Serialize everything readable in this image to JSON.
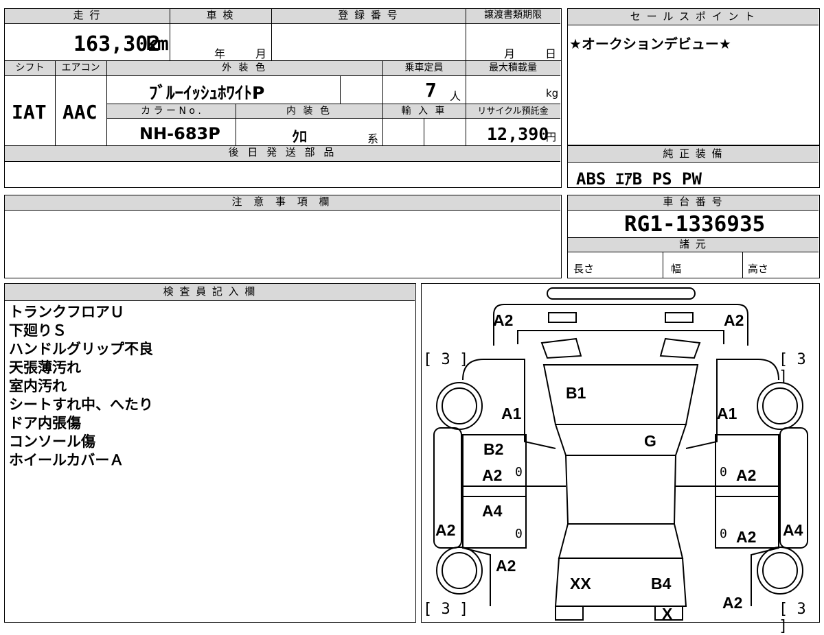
{
  "top_row": {
    "mileage_label": "走 行",
    "mileage_value": "163,302",
    "mileage_unit": "km",
    "inspection_label": "車 検",
    "inspection_year": "年",
    "inspection_month": "月",
    "registration_label": "登 録 番 号",
    "transfer_label": "譲渡書類期限",
    "transfer_month": "月",
    "transfer_day": "日"
  },
  "second_row": {
    "shift_label": "シフト",
    "shift_value": "IAT",
    "aircon_label": "エアコン",
    "aircon_value": "AAC",
    "exterior_label": "外 装 色",
    "exterior_value": "ﾌﾞﾙｰｲｯｼｭﾎﾜｲﾄP",
    "capacity_label": "乗車定員",
    "capacity_value": "7",
    "capacity_unit": "人",
    "maxload_label": "最大積載量",
    "maxload_unit": "kg",
    "color_no_label": "カ ラ ー N o .",
    "color_no_value": "NH-683P",
    "interior_label": "内 装 色",
    "interior_value": "ｸﾛ",
    "interior_suffix": "系",
    "import_label": "輸 入 車",
    "recycle_label": "リサイクル預託金",
    "recycle_value": "12,390",
    "recycle_unit": "円"
  },
  "sales_point": {
    "label": "セ ー ル ス ポ イ ン ト",
    "text": "★オークションデビュー★"
  },
  "later_parts": {
    "label": "後 日 発 送 部 品"
  },
  "equipment": {
    "label": "純 正 装 備",
    "value": "ABS ｴｱB PS PW"
  },
  "caution": {
    "label": "注 意 事 項 欄"
  },
  "chassis": {
    "label": "車 台 番 号",
    "value": "RG1-1336935",
    "specs_label": "諸 元",
    "length_label": "長さ",
    "width_label": "幅",
    "height_label": "高さ"
  },
  "inspector": {
    "label": "検 査 員 記 入 欄",
    "lines": [
      "トランクフロアＵ",
      "下廻りＳ",
      "ハンドルグリップ不良",
      "天張薄汚れ",
      "室内汚れ",
      "シートすれ中、へたり",
      "ドア内張傷",
      "コンソール傷",
      "ホイールカバーＡ"
    ]
  },
  "diagram": {
    "labels": {
      "front_left": "A2",
      "front_right": "A2",
      "tire_fl": "[ 3 ]",
      "tire_fr": "[ 3 ]",
      "hood": "B1",
      "fender_l": "A1",
      "fender_r": "A1",
      "windshield": "G",
      "door_fl_top": "B2",
      "door_fl": "A2",
      "door_fl_small": "0",
      "door_fr": "A2",
      "door_fr_small": "0",
      "door_rl_top": "A4",
      "door_rl_small": "0",
      "door_rr": "A2",
      "door_rr_small": "0",
      "sill_l": "A2",
      "sill_r": "A4",
      "quarter_l": "A2",
      "roof_rear_l": "XX",
      "roof_rear_r": "B4",
      "quarter_r": "A2",
      "tire_rl": "[ 3 ]",
      "tire_rr": "[ 3 ]",
      "rear_x": "X"
    }
  }
}
